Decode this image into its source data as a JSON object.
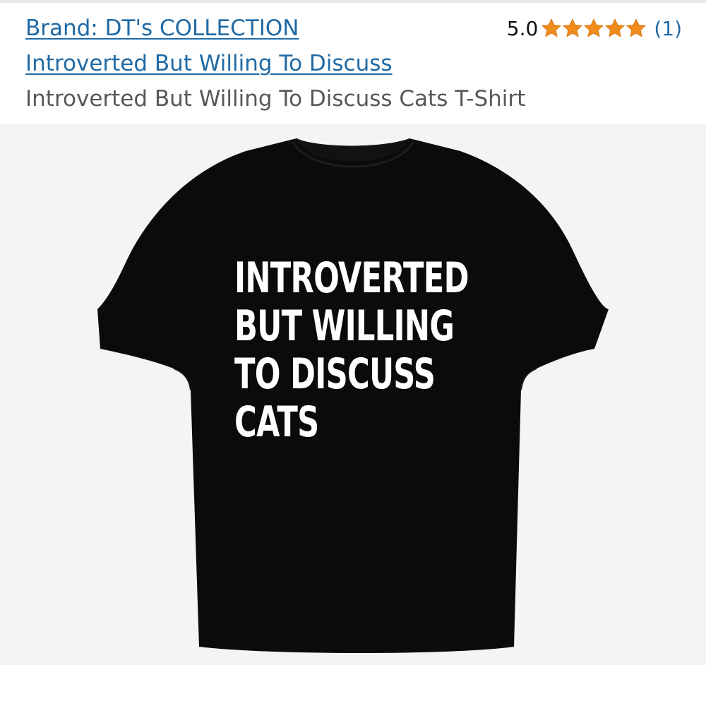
{
  "header": {
    "brand_link": "Brand: DT's COLLECTION",
    "collection_link": "Introverted But Willing To Discuss",
    "product_title": "Introverted But Willing To Discuss Cats T-Shirt"
  },
  "rating": {
    "value": "5.0",
    "stars": 5,
    "count": "(1)"
  },
  "product_image": {
    "print_lines": [
      "INTROVERTED",
      "BUT WILLING",
      "TO DISCUSS",
      "CATS"
    ],
    "shirt_color": "black"
  },
  "colors": {
    "link": "#1f6aa5",
    "star": "#f08c1c",
    "title_text": "#565959",
    "image_background": "#f4f4f4",
    "shirt": "#0b0b0d"
  },
  "icons": {
    "rating_star": "star-icon"
  }
}
